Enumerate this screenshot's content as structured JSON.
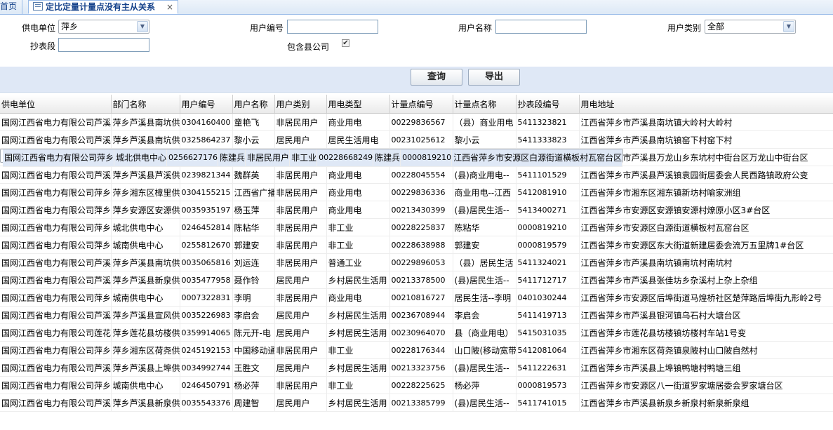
{
  "tabs": {
    "home_label": "首页",
    "active_label": "定比定量计量点没有主从关系",
    "close_glyph": "×"
  },
  "filters": {
    "supply_unit_label": "供电单位",
    "supply_unit_value": "萍乡",
    "user_no_label": "用户编号",
    "user_no_value": "",
    "user_name_label": "用户名称",
    "user_name_value": "",
    "user_type_label": "用户类别",
    "user_type_value": "全部",
    "meter_section_label": "抄表段",
    "meter_section_value": "",
    "include_county_label": "包含县公司",
    "include_county_checked": true
  },
  "actions": {
    "query_label": "查询",
    "export_label": "导出"
  },
  "grid": {
    "columns": [
      "供电单位",
      "部门名称",
      "用户编号",
      "用户名称",
      "用户类别",
      "用电类型",
      "计量点编号",
      "计量点名称",
      "抄表段编号",
      "用电地址"
    ],
    "selected_row": 2,
    "rows": [
      [
        "国网江西省电力有限公司芦溪",
        "萍乡芦溪县南坑供",
        "0304160400",
        "童艳飞",
        "非居民用户",
        "商业用电",
        "00229836567",
        "（县）商业用电",
        "5411323821",
        "江西省萍乡市芦溪县南坑镇大岭村大岭村"
      ],
      [
        "国网江西省电力有限公司芦溪",
        "萍乡芦溪县南坑供",
        "0325864237",
        "黎小云",
        "居民用户",
        "居民生活用电",
        "00231025612",
        "黎小云",
        "5411333823",
        "江西省萍乡市芦溪县南坑镇窑下村窑下村"
      ],
      [
        "国网江西省电力有限公司萍乡",
        "城北供电中心",
        "0256627176",
        "陈建兵",
        "非居民用户",
        "非工业",
        "00228668249",
        "陈建兵",
        "0000819210",
        "江西省萍乡市安源区白源街道横板村瓦窑台区"
      ],
      [
        "国网江西省电力有限公司芦溪",
        "萍乡芦溪县万龙山",
        "0035520782",
        "刘桂和",
        "非居民用户",
        "商业用电",
        "00213383299",
        "(县)居民生活--",
        "5411831519",
        "江西省萍乡市芦溪县万龙山乡东坑村中街台区万龙山中街台区"
      ],
      [
        "国网江西省电力有限公司芦溪",
        "萍乡芦溪县芦溪供",
        "0239821344",
        "魏群英",
        "非居民用户",
        "商业用电",
        "00228045554",
        "(县)商业用电--",
        "5411101529",
        "江西省萍乡市芦溪县芦溪镇袁园街居委会人民西路镇政府公变"
      ],
      [
        "国网江西省电力有限公司萍乡",
        "萍乡湘东区樟里供",
        "0304155215",
        "江西省广播",
        "非居民用户",
        "商业用电",
        "00229836336",
        "商业用电--江西",
        "5412081910",
        "江西省萍乡市湘东区湘东镇新坊村喻家洲组"
      ],
      [
        "国网江西省电力有限公司萍乡",
        "萍乡安源区安源供",
        "0035935197",
        "杨玉萍",
        "非居民用户",
        "商业用电",
        "00213430399",
        "(县)居民生活--",
        "5413400271",
        "江西省萍乡市安源区安源镇安源村燎原小区3#台区"
      ],
      [
        "国网江西省电力有限公司萍乡",
        "城北供电中心",
        "0246452814",
        "陈粘华",
        "非居民用户",
        "非工业",
        "00228225837",
        "陈粘华",
        "0000819210",
        "江西省萍乡市安源区白源街道横板村瓦窑台区"
      ],
      [
        "国网江西省电力有限公司萍乡",
        "城南供电中心",
        "0255812670",
        "郭建安",
        "非居民用户",
        "非工业",
        "00228638988",
        "郭建安",
        "0000819579",
        "江西省萍乡市安源区东大街道新建居委会流万五里牌1#台区"
      ],
      [
        "国网江西省电力有限公司芦溪",
        "萍乡芦溪县南坑供",
        "0035065816",
        "刘运连",
        "非居民用户",
        "普通工业",
        "00229896053",
        "（县）居民生活",
        "5411324021",
        "江西省萍乡市芦溪县南坑镇南坑村南坑村"
      ],
      [
        "国网江西省电力有限公司芦溪",
        "萍乡芦溪县新泉供",
        "0035477958",
        "聂作铃",
        "居民用户",
        "乡村居民生活用",
        "00213378500",
        "(县)居民生活--",
        "5411712717",
        "江西省萍乡市芦溪县张佳坊乡杂溪村上杂上杂组"
      ],
      [
        "国网江西省电力有限公司萍乡",
        "城南供电中心",
        "0007322831",
        "李明",
        "非居民用户",
        "商业用电",
        "00210816727",
        "居民生活--李明",
        "0401030244",
        "江西省萍乡市安源区后埠街道马煌桥社区楚萍路后埠街九形岭2号"
      ],
      [
        "国网江西省电力有限公司芦溪",
        "萍乡芦溪县宣风供",
        "0035226983",
        "李启会",
        "居民用户",
        "乡村居民生活用",
        "00236708944",
        "李启会",
        "5411419713",
        "江西省萍乡市芦溪县银河镇乌石村大塘台区"
      ],
      [
        "国网江西省电力有限公司莲花",
        "萍乡莲花县坊楼供",
        "0359914065",
        "陈元开-电",
        "居民用户",
        "乡村居民生活用",
        "00230964070",
        "县（商业用电）",
        "5415031035",
        "江西省萍乡市莲花县坊楼镇坊楼村车站1号变"
      ],
      [
        "国网江西省电力有限公司萍乡",
        "萍乡湘东区荷尧供",
        "0245192153",
        "中国移动通",
        "非居民用户",
        "非工业",
        "00228176344",
        "山口陂(移动宽带",
        "5412081064",
        "江西省萍乡市湘东区荷尧镇泉陂村山口陂自然村"
      ],
      [
        "国网江西省电力有限公司芦溪",
        "萍乡芦溪县上埠供",
        "0034992744",
        "王胜文",
        "居民用户",
        "乡村居民生活用",
        "00213323756",
        "(县)居民生活--",
        "5411222631",
        "江西省萍乡市芦溪县上埠镇鸭塘村鸭塘三组"
      ],
      [
        "国网江西省电力有限公司萍乡",
        "城南供电中心",
        "0246450791",
        "杨必萍",
        "非居民用户",
        "非工业",
        "00228225625",
        "杨必萍",
        "0000819573",
        "江西省萍乡市安源区八一街道罗家塘居委会罗家塘台区"
      ],
      [
        "国网江西省电力有限公司芦溪",
        "萍乡芦溪县新泉供",
        "0035543376",
        "周建智",
        "居民用户",
        "乡村居民生活用",
        "00213385799",
        "(县)居民生活--",
        "5411741015",
        "江西省萍乡市芦溪县新泉乡新泉村新泉新泉组"
      ]
    ]
  }
}
